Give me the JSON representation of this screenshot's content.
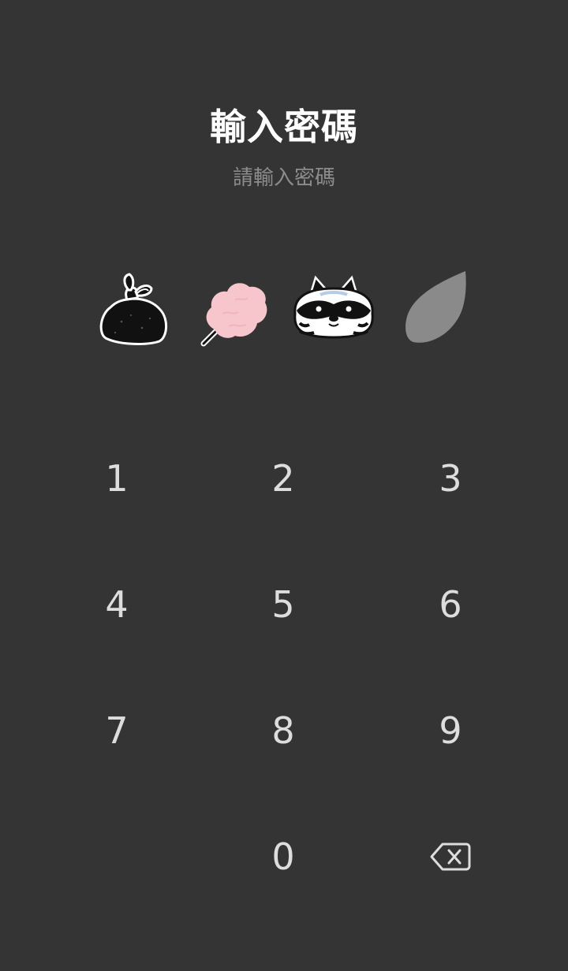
{
  "header": {
    "title": "輸入密碼",
    "subtitle": "請輸入密碼"
  },
  "pin_indicators": [
    {
      "icon": "garbage-bag-icon",
      "state": "filled"
    },
    {
      "icon": "cotton-candy-icon",
      "state": "filled"
    },
    {
      "icon": "raccoon-face-icon",
      "state": "filled"
    },
    {
      "icon": "leaf-icon",
      "state": "empty"
    }
  ],
  "keypad": {
    "keys": [
      "1",
      "2",
      "3",
      "4",
      "5",
      "6",
      "7",
      "8",
      "9",
      "0"
    ],
    "delete_icon": "backspace-icon"
  },
  "colors": {
    "background": "#343434",
    "title": "#ffffff",
    "subtitle": "#8c8c8c",
    "key_text": "#dddddd",
    "empty_indicator": "#8a8a8a",
    "cotton_candy": "#f6c6cc"
  }
}
